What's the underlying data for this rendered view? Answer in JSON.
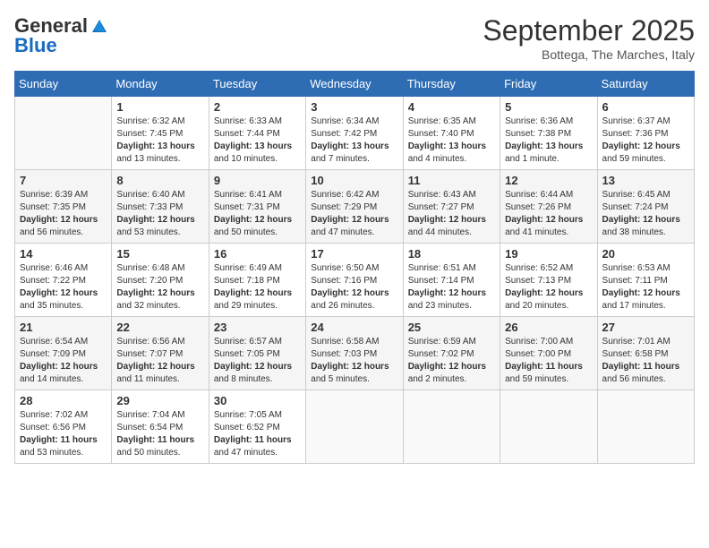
{
  "logo": {
    "general": "General",
    "blue": "Blue"
  },
  "title": "September 2025",
  "subtitle": "Bottega, The Marches, Italy",
  "days_of_week": [
    "Sunday",
    "Monday",
    "Tuesday",
    "Wednesday",
    "Thursday",
    "Friday",
    "Saturday"
  ],
  "weeks": [
    [
      {
        "day": "",
        "content": ""
      },
      {
        "day": "1",
        "content": "Sunrise: 6:32 AM\nSunset: 7:45 PM\nDaylight: 13 hours\nand 13 minutes."
      },
      {
        "day": "2",
        "content": "Sunrise: 6:33 AM\nSunset: 7:44 PM\nDaylight: 13 hours\nand 10 minutes."
      },
      {
        "day": "3",
        "content": "Sunrise: 6:34 AM\nSunset: 7:42 PM\nDaylight: 13 hours\nand 7 minutes."
      },
      {
        "day": "4",
        "content": "Sunrise: 6:35 AM\nSunset: 7:40 PM\nDaylight: 13 hours\nand 4 minutes."
      },
      {
        "day": "5",
        "content": "Sunrise: 6:36 AM\nSunset: 7:38 PM\nDaylight: 13 hours\nand 1 minute."
      },
      {
        "day": "6",
        "content": "Sunrise: 6:37 AM\nSunset: 7:36 PM\nDaylight: 12 hours\nand 59 minutes."
      }
    ],
    [
      {
        "day": "7",
        "content": "Sunrise: 6:39 AM\nSunset: 7:35 PM\nDaylight: 12 hours\nand 56 minutes."
      },
      {
        "day": "8",
        "content": "Sunrise: 6:40 AM\nSunset: 7:33 PM\nDaylight: 12 hours\nand 53 minutes."
      },
      {
        "day": "9",
        "content": "Sunrise: 6:41 AM\nSunset: 7:31 PM\nDaylight: 12 hours\nand 50 minutes."
      },
      {
        "day": "10",
        "content": "Sunrise: 6:42 AM\nSunset: 7:29 PM\nDaylight: 12 hours\nand 47 minutes."
      },
      {
        "day": "11",
        "content": "Sunrise: 6:43 AM\nSunset: 7:27 PM\nDaylight: 12 hours\nand 44 minutes."
      },
      {
        "day": "12",
        "content": "Sunrise: 6:44 AM\nSunset: 7:26 PM\nDaylight: 12 hours\nand 41 minutes."
      },
      {
        "day": "13",
        "content": "Sunrise: 6:45 AM\nSunset: 7:24 PM\nDaylight: 12 hours\nand 38 minutes."
      }
    ],
    [
      {
        "day": "14",
        "content": "Sunrise: 6:46 AM\nSunset: 7:22 PM\nDaylight: 12 hours\nand 35 minutes."
      },
      {
        "day": "15",
        "content": "Sunrise: 6:48 AM\nSunset: 7:20 PM\nDaylight: 12 hours\nand 32 minutes."
      },
      {
        "day": "16",
        "content": "Sunrise: 6:49 AM\nSunset: 7:18 PM\nDaylight: 12 hours\nand 29 minutes."
      },
      {
        "day": "17",
        "content": "Sunrise: 6:50 AM\nSunset: 7:16 PM\nDaylight: 12 hours\nand 26 minutes."
      },
      {
        "day": "18",
        "content": "Sunrise: 6:51 AM\nSunset: 7:14 PM\nDaylight: 12 hours\nand 23 minutes."
      },
      {
        "day": "19",
        "content": "Sunrise: 6:52 AM\nSunset: 7:13 PM\nDaylight: 12 hours\nand 20 minutes."
      },
      {
        "day": "20",
        "content": "Sunrise: 6:53 AM\nSunset: 7:11 PM\nDaylight: 12 hours\nand 17 minutes."
      }
    ],
    [
      {
        "day": "21",
        "content": "Sunrise: 6:54 AM\nSunset: 7:09 PM\nDaylight: 12 hours\nand 14 minutes."
      },
      {
        "day": "22",
        "content": "Sunrise: 6:56 AM\nSunset: 7:07 PM\nDaylight: 12 hours\nand 11 minutes."
      },
      {
        "day": "23",
        "content": "Sunrise: 6:57 AM\nSunset: 7:05 PM\nDaylight: 12 hours\nand 8 minutes."
      },
      {
        "day": "24",
        "content": "Sunrise: 6:58 AM\nSunset: 7:03 PM\nDaylight: 12 hours\nand 5 minutes."
      },
      {
        "day": "25",
        "content": "Sunrise: 6:59 AM\nSunset: 7:02 PM\nDaylight: 12 hours\nand 2 minutes."
      },
      {
        "day": "26",
        "content": "Sunrise: 7:00 AM\nSunset: 7:00 PM\nDaylight: 11 hours\nand 59 minutes."
      },
      {
        "day": "27",
        "content": "Sunrise: 7:01 AM\nSunset: 6:58 PM\nDaylight: 11 hours\nand 56 minutes."
      }
    ],
    [
      {
        "day": "28",
        "content": "Sunrise: 7:02 AM\nSunset: 6:56 PM\nDaylight: 11 hours\nand 53 minutes."
      },
      {
        "day": "29",
        "content": "Sunrise: 7:04 AM\nSunset: 6:54 PM\nDaylight: 11 hours\nand 50 minutes."
      },
      {
        "day": "30",
        "content": "Sunrise: 7:05 AM\nSunset: 6:52 PM\nDaylight: 11 hours\nand 47 minutes."
      },
      {
        "day": "",
        "content": ""
      },
      {
        "day": "",
        "content": ""
      },
      {
        "day": "",
        "content": ""
      },
      {
        "day": "",
        "content": ""
      }
    ]
  ]
}
